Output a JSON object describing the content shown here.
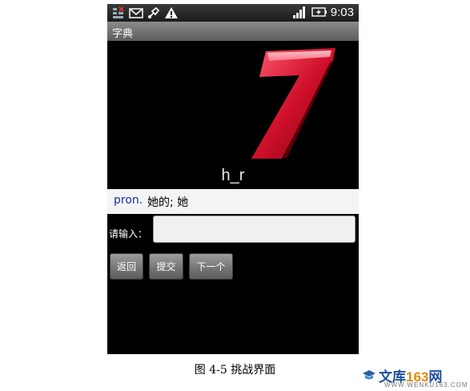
{
  "statusbar": {
    "clock": "9:03",
    "icons": [
      "notification-icon",
      "mail-icon",
      "usb-debug-icon",
      "warning-icon",
      "signal-icon",
      "battery-charging-icon"
    ]
  },
  "titlebar": {
    "title": "字典"
  },
  "challenge": {
    "hint_word": "h_r",
    "part_of_speech": "pron.",
    "definition": "她的; 她"
  },
  "form": {
    "input_label": "请输入：",
    "input_value": ""
  },
  "buttons": {
    "back": "返回",
    "submit": "提交",
    "next": "下一个"
  },
  "caption": "图 4-5  挑战界面",
  "watermark": {
    "brand": "文库",
    "number": "163",
    "suffix": "网",
    "url": "WWW.WENKU163.COM"
  },
  "colors": {
    "phone_bg": "#000000",
    "pos_text": "#1a2fa5",
    "seven_red": "#d0102a"
  }
}
